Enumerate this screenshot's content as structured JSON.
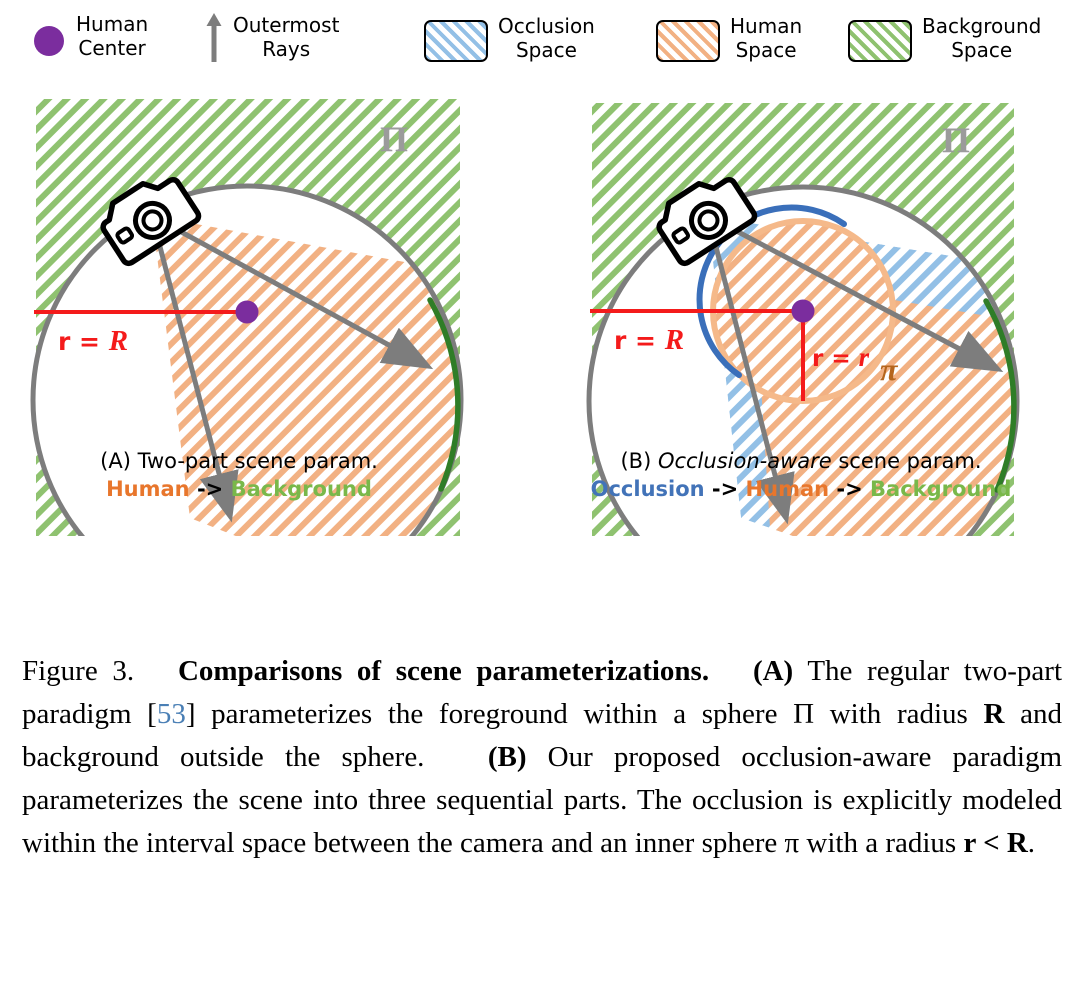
{
  "legend": {
    "items": [
      {
        "icon": "purple-dot-icon",
        "label": "Human\nCenter",
        "color": "#7B2D9E"
      },
      {
        "icon": "up-arrow-icon",
        "label": "Outermost\nRays",
        "color": "#808080"
      },
      {
        "icon": "blue-hatch-swatch-icon",
        "label": "Occlusion\nSpace",
        "color": "#93c0e6"
      },
      {
        "icon": "orange-hatch-swatch-icon",
        "label": "Human\nSpace",
        "color": "#f2b183"
      },
      {
        "icon": "green-hatch-swatch-icon",
        "label": "Background\nSpace",
        "color": "#8fc270"
      }
    ]
  },
  "panels": [
    {
      "id": "A",
      "sphere_label": "Π",
      "radius_label_outer": "r = R",
      "caption_line1_prefix": "(A) ",
      "caption_line1_italic": "",
      "caption_line1_suffix": "Two-part scene param.",
      "caption_sequence": [
        "Human",
        "Background"
      ],
      "inner_sphere_label": "",
      "radius_label_inner": ""
    },
    {
      "id": "B",
      "sphere_label": "Π",
      "radius_label_outer": "r = R",
      "caption_line1_prefix": "(B) ",
      "caption_line1_italic": "Occlusion-aware",
      "caption_line1_suffix": " scene param.",
      "caption_sequence": [
        "Occlusion",
        "Human",
        "Background"
      ],
      "inner_sphere_label": "π",
      "radius_label_inner": "r = r"
    }
  ],
  "arrow_separator": "->",
  "figure_caption": {
    "label": "Figure 3.",
    "bold_title": "Comparisons of scene parameterizations.",
    "part_a_tag": "(A)",
    "text_a_1": "The regular two-part paradigm [",
    "citation": "53",
    "text_a_2": "] parameterizes the foreground within a sphere Π with radius ",
    "radius_R": "R",
    "text_a_3": " and background outside the sphere.",
    "part_b_tag": "(B)",
    "text_b_1": "Our proposed occlusion-aware paradigm parameterizes the scene into three sequential parts. The occlusion is explicitly modeled within the interval space between the camera and an inner sphere π with a radius ",
    "radius_rR": "r < R",
    "text_b_2": "."
  },
  "colors": {
    "human_center": "#7B2D9E",
    "ray_gray": "#7d7d7d",
    "sphere_outline": "#7d7d7d",
    "background_green": "#8fc270",
    "background_arc_green": "#2f7d27",
    "human_orange": "#f2b183",
    "occlusion_blue": "#93c0e6",
    "inner_arc_blue": "#3a6fba",
    "inner_arc_orange": "#f5b98a",
    "radius_red": "#f41b1b",
    "pi_brown": "#b5651d",
    "caption_occlusion": "#4273b8",
    "caption_human": "#E8762C",
    "caption_background": "#79B84A",
    "citation_blue": "#4a7fb5"
  }
}
